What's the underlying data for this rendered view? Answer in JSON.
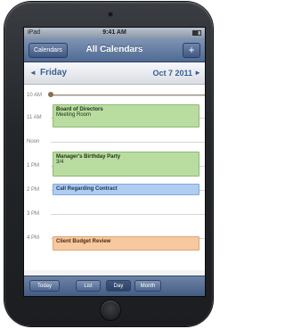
{
  "status": {
    "carrier": "iPad",
    "time": "9:41 AM"
  },
  "navbar": {
    "calendars_button": "Calendars",
    "title": "All Calendars",
    "add_button": "+"
  },
  "daybar": {
    "prev_arrow": "◄",
    "day": "Friday",
    "date": "Oct 7 2011",
    "next_arrow": "►"
  },
  "timeline": {
    "hours": [
      "10 AM",
      "11 AM",
      "Noon",
      "1 PM",
      "2 PM",
      "3 PM",
      "4 PM"
    ],
    "events": [
      {
        "title": "Board of Directors",
        "subtitle": "Meeting Room",
        "color": "green"
      },
      {
        "title": "Manager's Birthday Party",
        "subtitle": "3/4",
        "color": "green"
      },
      {
        "title": "Call Regarding Contract",
        "subtitle": "",
        "color": "blue"
      },
      {
        "title": "Client Budget Review",
        "subtitle": "",
        "color": "orange"
      }
    ]
  },
  "tabbar": {
    "tabs": [
      "Today",
      "List",
      "Day",
      "Month"
    ],
    "active": "Day"
  },
  "colors": {
    "event_green": "#b9dca0",
    "event_blue": "#afcdf0",
    "event_orange": "#f6c9a0",
    "nav_blue": "#4f6a93"
  }
}
